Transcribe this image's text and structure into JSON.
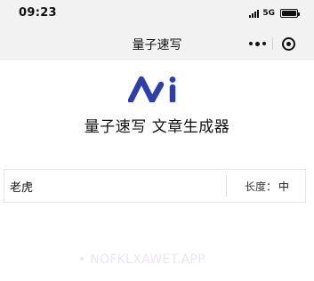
{
  "status_bar": {
    "time": "09:23",
    "network": "5G",
    "icons": [
      "signal-icon",
      "battery-icon"
    ]
  },
  "nav": {
    "title": "量子速写",
    "icons": [
      "more-icon",
      "close-target-icon"
    ]
  },
  "hero": {
    "logo": "ai-logo",
    "headline": "量子速写 文章生成器",
    "logo_color": "#2f3fa8"
  },
  "form": {
    "topic_value": "老虎",
    "length_label": "长度：",
    "length_value": "中"
  },
  "watermark": "• NOFKLXAWET.APP"
}
